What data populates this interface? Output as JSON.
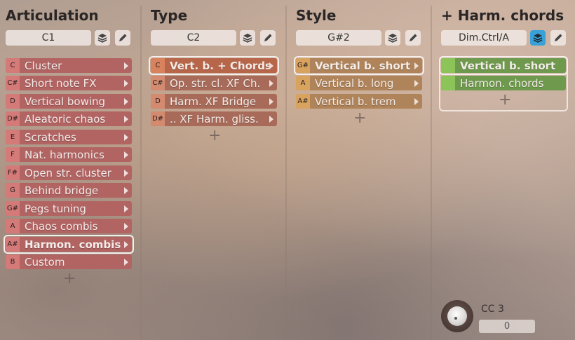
{
  "columns": {
    "articulation": {
      "title": "Articulation",
      "key": "C1",
      "items": [
        {
          "key": "C",
          "label": "Cluster"
        },
        {
          "key": "C#",
          "label": "Short note FX"
        },
        {
          "key": "D",
          "label": "Vertical bowing"
        },
        {
          "key": "D#",
          "label": "Aleatoric chaos"
        },
        {
          "key": "E",
          "label": "Scratches"
        },
        {
          "key": "F",
          "label": "Nat. harmonics"
        },
        {
          "key": "F#",
          "label": "Open str. cluster"
        },
        {
          "key": "G",
          "label": "Behind bridge"
        },
        {
          "key": "G#",
          "label": "Pegs tuning"
        },
        {
          "key": "A",
          "label": "Chaos combis"
        },
        {
          "key": "A#",
          "label": "Harmon. combis"
        },
        {
          "key": "B",
          "label": "Custom"
        }
      ],
      "add": "+"
    },
    "type": {
      "title": "Type",
      "key": "C2",
      "items": [
        {
          "key": "C",
          "label": "Vert. b. + Chords"
        },
        {
          "key": "C#",
          "label": "Op. str. cl. XF Ch."
        },
        {
          "key": "D",
          "label": "Harm. XF Bridge"
        },
        {
          "key": "D#",
          "label": ".. XF Harm. gliss."
        }
      ],
      "add": "+"
    },
    "style": {
      "title": "Style",
      "key": "G#2",
      "items": [
        {
          "key": "G#",
          "label": "Vertical b. short"
        },
        {
          "key": "A",
          "label": "Vertical b. long"
        },
        {
          "key": "A#",
          "label": "Vertical b. trem"
        }
      ],
      "add": "+"
    },
    "harm": {
      "title": "+ Harm. chords",
      "key": "Dim.Ctrl/A",
      "items": [
        {
          "label": "Vertical b. short"
        },
        {
          "label": "Harmon. chords"
        }
      ],
      "add": "+"
    }
  },
  "cc": {
    "label": "CC 3",
    "value": "0"
  },
  "icons": {
    "layers": "layers-icon",
    "edit": "pencil-icon"
  },
  "colors": {
    "articulation": "#b26463",
    "type": "#a86b5a",
    "style": "#b0845a",
    "harm": "#6f9a4e",
    "active_toggle": "#3aa0d8"
  }
}
